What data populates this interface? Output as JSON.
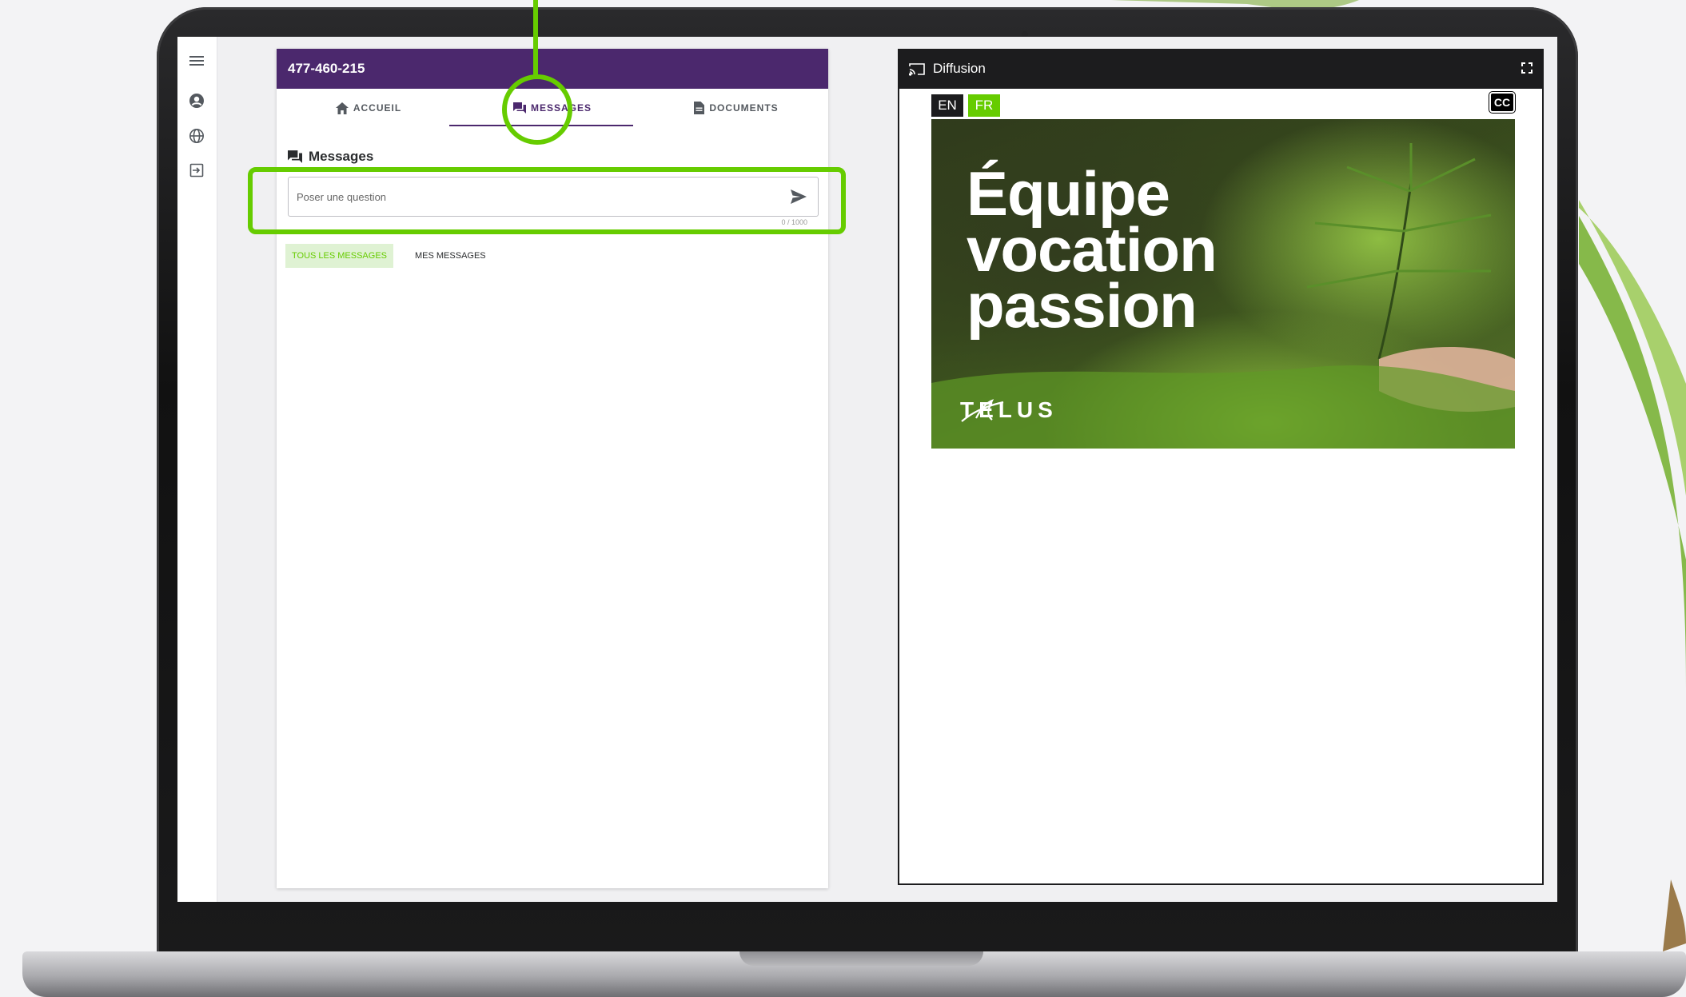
{
  "rail": {
    "icons": [
      "menu-icon",
      "user-icon",
      "globe-icon",
      "logout-icon"
    ]
  },
  "chat": {
    "header_title": "477-460-215",
    "tabs": [
      {
        "label": "ACCUEIL",
        "icon": "home-icon"
      },
      {
        "label": "MESSAGES",
        "icon": "forum-icon",
        "active": true
      },
      {
        "label": "DOCUMENTS",
        "icon": "document-icon"
      }
    ],
    "section_title": "Messages",
    "input_placeholder": "Poser une question",
    "char_counter": "0 / 1000",
    "filters": {
      "all": "TOUS LES MESSAGES",
      "mine": "MES MESSAGES"
    }
  },
  "stream": {
    "title": "Diffusion",
    "lang_en": "EN",
    "lang_fr": "FR",
    "cc_label": "CC",
    "video_headline": "Équipe\nvocation\npassion",
    "video_logo": "TELUS"
  },
  "colors": {
    "purple": "#4b286d",
    "green": "#66cc00",
    "dark": "#1c1c1e"
  }
}
